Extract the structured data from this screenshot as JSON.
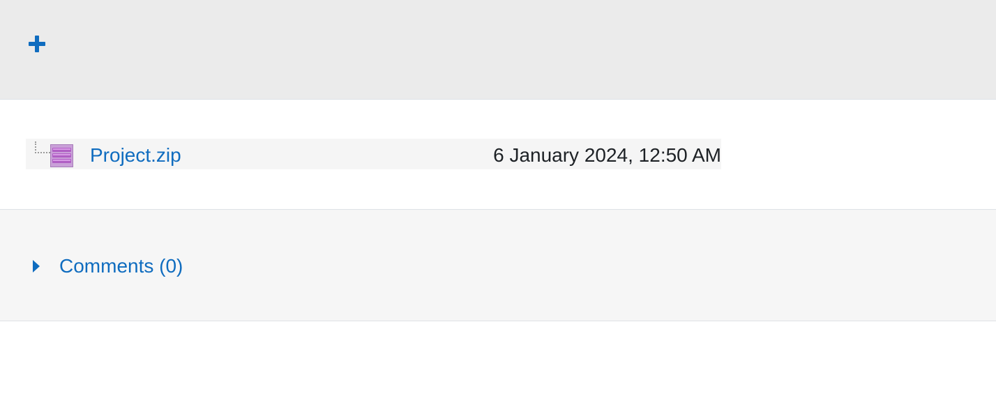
{
  "header": {
    "add_icon": "plus-icon",
    "accent_color": "#0f6cbf"
  },
  "files": [
    {
      "name": "Project.zip",
      "icon": "archive-file-icon",
      "date": "6 January 2024, 12:50 AM"
    }
  ],
  "comments": {
    "label": "Comments (0)",
    "icon": "caret-right-icon"
  }
}
